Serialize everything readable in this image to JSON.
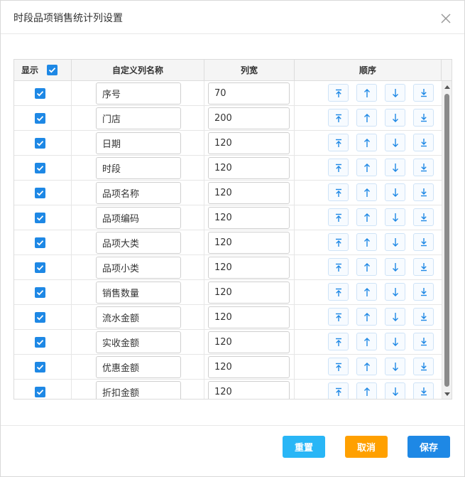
{
  "dialog": {
    "title": "时段品项销售统计列设置"
  },
  "colors": {
    "accent": "#1e88e5",
    "reset_bg": "#29b6f6",
    "cancel_bg": "#ffa000",
    "save_bg": "#1e88e5",
    "order_icon": "#1e88e5"
  },
  "table": {
    "headers": {
      "show": "显示",
      "name": "自定义列名称",
      "width": "列宽",
      "order": "顺序"
    },
    "header_checkbox_checked": true,
    "order_icons": [
      "move-to-top-icon",
      "move-up-icon",
      "move-down-icon",
      "move-to-bottom-icon"
    ],
    "rows": [
      {
        "checked": true,
        "name": "序号",
        "width": "70"
      },
      {
        "checked": true,
        "name": "门店",
        "width": "200"
      },
      {
        "checked": true,
        "name": "日期",
        "width": "120"
      },
      {
        "checked": true,
        "name": "时段",
        "width": "120"
      },
      {
        "checked": true,
        "name": "品项名称",
        "width": "120"
      },
      {
        "checked": true,
        "name": "品项编码",
        "width": "120"
      },
      {
        "checked": true,
        "name": "品项大类",
        "width": "120"
      },
      {
        "checked": true,
        "name": "品项小类",
        "width": "120"
      },
      {
        "checked": true,
        "name": "销售数量",
        "width": "120"
      },
      {
        "checked": true,
        "name": "流水金额",
        "width": "120"
      },
      {
        "checked": true,
        "name": "实收金额",
        "width": "120"
      },
      {
        "checked": true,
        "name": "优惠金额",
        "width": "120"
      },
      {
        "checked": true,
        "name": "折扣金额",
        "width": "120"
      }
    ]
  },
  "footer": {
    "reset_label": "重置",
    "cancel_label": "取消",
    "save_label": "保存"
  }
}
